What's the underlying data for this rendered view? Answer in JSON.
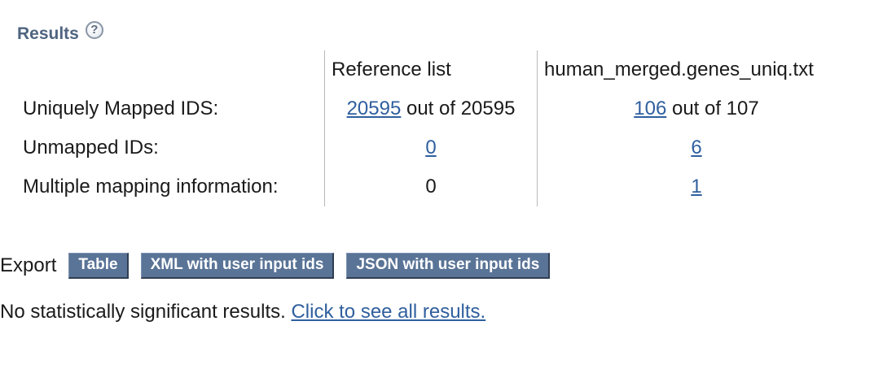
{
  "results": {
    "title": "Results",
    "help_icon_glyph": "?"
  },
  "table": {
    "headers": {
      "reference": "Reference list",
      "user_file": "human_merged.genes_uniq.txt"
    },
    "rows": [
      {
        "label": "Uniquely Mapped IDS:",
        "reference": {
          "link": "20595",
          "suffix": " out of 20595"
        },
        "user": {
          "link": "106",
          "suffix": " out of 107"
        }
      },
      {
        "label": "Unmapped IDs:",
        "reference": {
          "link": "0",
          "suffix": ""
        },
        "user": {
          "link": "6",
          "suffix": ""
        }
      },
      {
        "label": "Multiple mapping information:",
        "reference": {
          "text": "0"
        },
        "user": {
          "link": "1",
          "suffix": ""
        }
      }
    ]
  },
  "export": {
    "label": "Export",
    "buttons": [
      "Table",
      "XML with user input ids",
      "JSON with user input ids"
    ]
  },
  "message": {
    "text": "No statistically significant results. ",
    "link": "Click to see all results."
  },
  "colors": {
    "heading": "#4f6480",
    "link": "#2f5f9e",
    "button_bg": "#5a7497"
  }
}
